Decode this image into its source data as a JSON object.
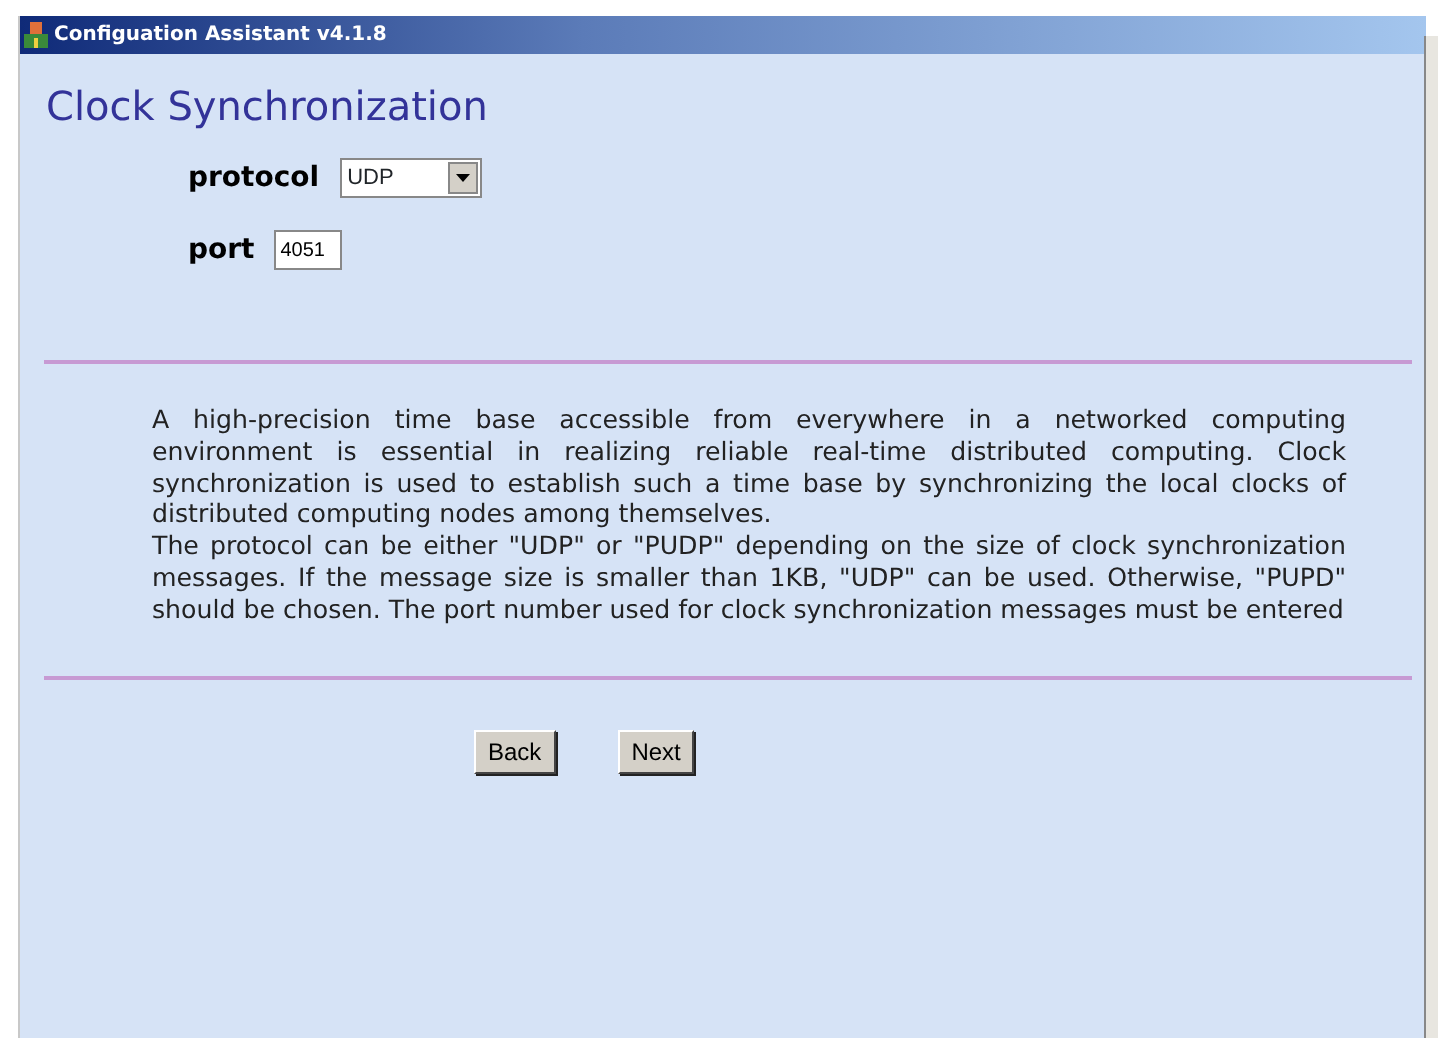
{
  "window": {
    "title": "Configuation Assistant v4.1.8"
  },
  "heading": "Clock Synchronization",
  "fields": [
    {
      "kind": "select",
      "label": "protocol",
      "value": "UDP"
    },
    {
      "kind": "text",
      "label": "port",
      "value": "4051"
    }
  ],
  "description": [
    "A high-precision time base accessible from everywhere in a networked computing environment is essential in realizing reliable real-time distributed computing. Clock synchronization is used to establish such a time base by synchronizing the local clocks of distributed computing nodes among themselves.",
    "The protocol can be either \"UDP\" or \"PUDP\" depending on the size of clock synchronization messages. If the message size is smaller than 1KB, \"UDP\" can be used. Otherwise, \"PUPD\" should be chosen. The port number used for clock synchronization messages must be entered"
  ],
  "buttons": [
    "Back",
    "Next"
  ]
}
